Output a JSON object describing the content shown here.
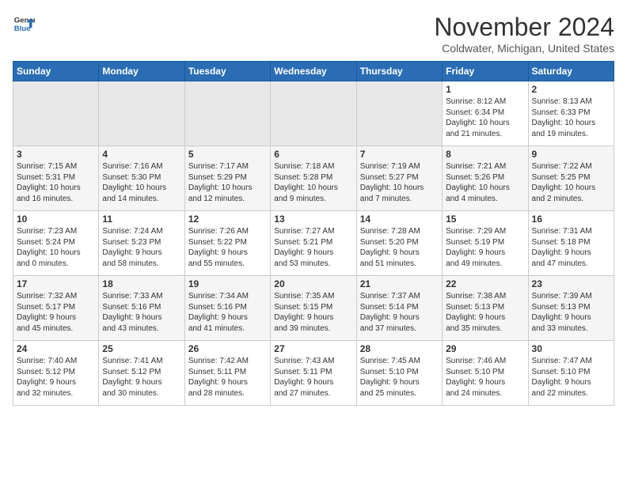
{
  "header": {
    "logo_line1": "General",
    "logo_line2": "Blue",
    "month_year": "November 2024",
    "location": "Coldwater, Michigan, United States"
  },
  "weekdays": [
    "Sunday",
    "Monday",
    "Tuesday",
    "Wednesday",
    "Thursday",
    "Friday",
    "Saturday"
  ],
  "weeks": [
    [
      {
        "day": "",
        "info": ""
      },
      {
        "day": "",
        "info": ""
      },
      {
        "day": "",
        "info": ""
      },
      {
        "day": "",
        "info": ""
      },
      {
        "day": "",
        "info": ""
      },
      {
        "day": "1",
        "info": "Sunrise: 8:12 AM\nSunset: 6:34 PM\nDaylight: 10 hours\nand 21 minutes."
      },
      {
        "day": "2",
        "info": "Sunrise: 8:13 AM\nSunset: 6:33 PM\nDaylight: 10 hours\nand 19 minutes."
      }
    ],
    [
      {
        "day": "3",
        "info": "Sunrise: 7:15 AM\nSunset: 5:31 PM\nDaylight: 10 hours\nand 16 minutes."
      },
      {
        "day": "4",
        "info": "Sunrise: 7:16 AM\nSunset: 5:30 PM\nDaylight: 10 hours\nand 14 minutes."
      },
      {
        "day": "5",
        "info": "Sunrise: 7:17 AM\nSunset: 5:29 PM\nDaylight: 10 hours\nand 12 minutes."
      },
      {
        "day": "6",
        "info": "Sunrise: 7:18 AM\nSunset: 5:28 PM\nDaylight: 10 hours\nand 9 minutes."
      },
      {
        "day": "7",
        "info": "Sunrise: 7:19 AM\nSunset: 5:27 PM\nDaylight: 10 hours\nand 7 minutes."
      },
      {
        "day": "8",
        "info": "Sunrise: 7:21 AM\nSunset: 5:26 PM\nDaylight: 10 hours\nand 4 minutes."
      },
      {
        "day": "9",
        "info": "Sunrise: 7:22 AM\nSunset: 5:25 PM\nDaylight: 10 hours\nand 2 minutes."
      }
    ],
    [
      {
        "day": "10",
        "info": "Sunrise: 7:23 AM\nSunset: 5:24 PM\nDaylight: 10 hours\nand 0 minutes."
      },
      {
        "day": "11",
        "info": "Sunrise: 7:24 AM\nSunset: 5:23 PM\nDaylight: 9 hours\nand 58 minutes."
      },
      {
        "day": "12",
        "info": "Sunrise: 7:26 AM\nSunset: 5:22 PM\nDaylight: 9 hours\nand 55 minutes."
      },
      {
        "day": "13",
        "info": "Sunrise: 7:27 AM\nSunset: 5:21 PM\nDaylight: 9 hours\nand 53 minutes."
      },
      {
        "day": "14",
        "info": "Sunrise: 7:28 AM\nSunset: 5:20 PM\nDaylight: 9 hours\nand 51 minutes."
      },
      {
        "day": "15",
        "info": "Sunrise: 7:29 AM\nSunset: 5:19 PM\nDaylight: 9 hours\nand 49 minutes."
      },
      {
        "day": "16",
        "info": "Sunrise: 7:31 AM\nSunset: 5:18 PM\nDaylight: 9 hours\nand 47 minutes."
      }
    ],
    [
      {
        "day": "17",
        "info": "Sunrise: 7:32 AM\nSunset: 5:17 PM\nDaylight: 9 hours\nand 45 minutes."
      },
      {
        "day": "18",
        "info": "Sunrise: 7:33 AM\nSunset: 5:16 PM\nDaylight: 9 hours\nand 43 minutes."
      },
      {
        "day": "19",
        "info": "Sunrise: 7:34 AM\nSunset: 5:16 PM\nDaylight: 9 hours\nand 41 minutes."
      },
      {
        "day": "20",
        "info": "Sunrise: 7:35 AM\nSunset: 5:15 PM\nDaylight: 9 hours\nand 39 minutes."
      },
      {
        "day": "21",
        "info": "Sunrise: 7:37 AM\nSunset: 5:14 PM\nDaylight: 9 hours\nand 37 minutes."
      },
      {
        "day": "22",
        "info": "Sunrise: 7:38 AM\nSunset: 5:13 PM\nDaylight: 9 hours\nand 35 minutes."
      },
      {
        "day": "23",
        "info": "Sunrise: 7:39 AM\nSunset: 5:13 PM\nDaylight: 9 hours\nand 33 minutes."
      }
    ],
    [
      {
        "day": "24",
        "info": "Sunrise: 7:40 AM\nSunset: 5:12 PM\nDaylight: 9 hours\nand 32 minutes."
      },
      {
        "day": "25",
        "info": "Sunrise: 7:41 AM\nSunset: 5:12 PM\nDaylight: 9 hours\nand 30 minutes."
      },
      {
        "day": "26",
        "info": "Sunrise: 7:42 AM\nSunset: 5:11 PM\nDaylight: 9 hours\nand 28 minutes."
      },
      {
        "day": "27",
        "info": "Sunrise: 7:43 AM\nSunset: 5:11 PM\nDaylight: 9 hours\nand 27 minutes."
      },
      {
        "day": "28",
        "info": "Sunrise: 7:45 AM\nSunset: 5:10 PM\nDaylight: 9 hours\nand 25 minutes."
      },
      {
        "day": "29",
        "info": "Sunrise: 7:46 AM\nSunset: 5:10 PM\nDaylight: 9 hours\nand 24 minutes."
      },
      {
        "day": "30",
        "info": "Sunrise: 7:47 AM\nSunset: 5:10 PM\nDaylight: 9 hours\nand 22 minutes."
      }
    ]
  ]
}
